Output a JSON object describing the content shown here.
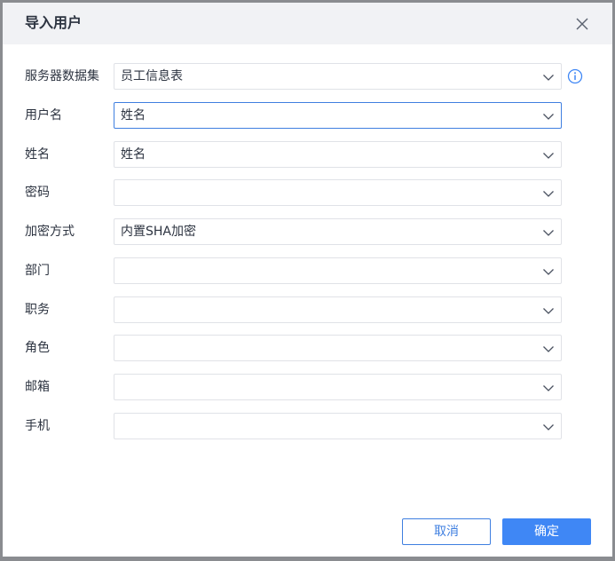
{
  "dialog": {
    "title": "导入用户",
    "close_icon": "close-icon"
  },
  "form": {
    "fields": [
      {
        "label": "服务器数据集",
        "value": "员工信息表",
        "has_info": true
      },
      {
        "label": "用户名",
        "value": "姓名",
        "focused": true
      },
      {
        "label": "姓名",
        "value": "姓名"
      },
      {
        "label": "密码",
        "value": ""
      },
      {
        "label": "加密方式",
        "value": "内置SHA加密"
      },
      {
        "label": "部门",
        "value": ""
      },
      {
        "label": "职务",
        "value": ""
      },
      {
        "label": "角色",
        "value": ""
      },
      {
        "label": "邮箱",
        "value": ""
      },
      {
        "label": "手机",
        "value": ""
      }
    ],
    "dropdown_icon": "chevron-down-icon",
    "info_icon": "info-icon"
  },
  "footer": {
    "cancel_label": "取消",
    "ok_label": "确定"
  },
  "colors": {
    "accent": "#3f87f5",
    "focus_border": "#3f7fe0",
    "header_bg": "#f1f2f5",
    "overlay": "#8a8c90"
  }
}
